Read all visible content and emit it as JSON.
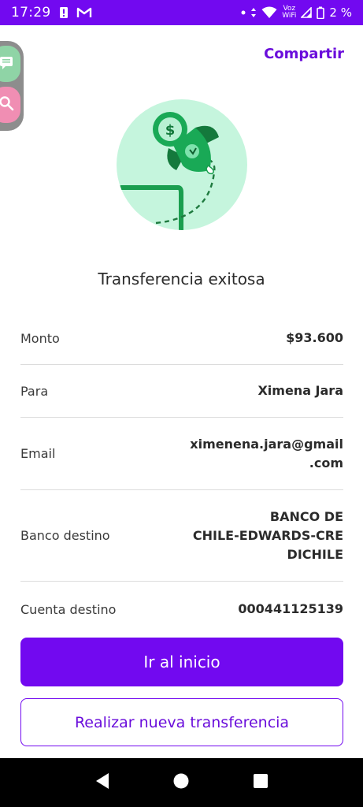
{
  "status_bar": {
    "time": "17:29",
    "voz": "Voz",
    "wifi": "WiFi",
    "battery": "2 %"
  },
  "header": {
    "share_label": "Compartir"
  },
  "title": "Transferencia exitosa",
  "details": [
    {
      "label": "Monto",
      "value": "$93.600"
    },
    {
      "label": "Para",
      "value": "Ximena Jara"
    },
    {
      "label": "Email",
      "value": "ximenena.jara@gmail\n.com"
    },
    {
      "label": "Banco destino",
      "value": "BANCO DE\nCHILE-EDWARDS-CRE\nDICHILE"
    },
    {
      "label": "Cuenta destino",
      "value": "000441125139"
    }
  ],
  "buttons": {
    "primary": "Ir al inicio",
    "secondary": "Realizar nueva transferencia"
  },
  "colors": {
    "accent": "#7209f0",
    "hero_bg": "#c5f5dd",
    "hero_green": "#1a9e4f"
  },
  "icons": {
    "nav_back": "back-icon",
    "nav_home": "home-icon",
    "nav_recents": "recents-icon"
  }
}
